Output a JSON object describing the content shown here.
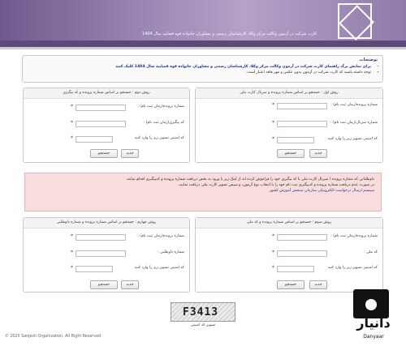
{
  "banner": {
    "text": "کارت شرکت در آزمون وکالت مرکز وکلا، کارشناسان رسمی و مشاوران خانواده قوه قضاییه سال 1404"
  },
  "notes": {
    "title": "توضیحات",
    "items": [
      "برای نمایش برگ راهنمای کارت شرکت در آزمون وکالت مرکز وکلا، کارشناسان رسمی و مشاوران خانواده قوه قضاییه سال 1404 کلیک کنید",
      "توجه داشته باشید که کارت شرکت در آزمون بدون عکس و مهر فاقد اعتبار است."
    ]
  },
  "panels": {
    "p1": {
      "title": "روش اول : جستجو بر اساس شماره پرونده و سریال کارت ملی",
      "fields": [
        "شماره پرونده(زمان ثبت نام) :",
        "شماره سریال(زمان ثبت نام) :",
        "کد امنیتی تصویر زیر را وارد کنید"
      ],
      "search": "جستجو",
      "new": "جدید"
    },
    "p2": {
      "title": "روش دوم : جستجو بر اساس شماره پرونده و کد پیگیری",
      "fields": [
        "شماره پرونده(زمان ثبت نام) :",
        "کد پیگیری(زمان ثبت نام) :",
        "کد امنیتی تصویر زیر را وارد کنید"
      ],
      "search": "جستجو",
      "new": "جدید"
    },
    "p3": {
      "title": "روش سوم : جستجو بر اساس شماره پرونده و کد ملی",
      "fields": [
        "شماره پرونده(زمان ثبت نام) :",
        "کد ملی :",
        "کد امنیتی تصویر زیر را وارد کنید"
      ],
      "search": "جستجو",
      "new": "جدید"
    },
    "p4": {
      "title": "روش چهارم : جستجو بر اساس شماره پرونده و شماره داوطلبی",
      "fields": [
        "شماره پرونده(زمان ثبت نام) :",
        "شماره داوطلبی :",
        "کد امنیتی تصویر زیر را وارد کنید"
      ],
      "search": "جستجو",
      "new": "جدید"
    }
  },
  "info": {
    "line1": "داوطلبانی که شماره پرونده / سریال کارت ملی یا کد پیگیری خود را فراموش کرده اند از لینک زیر با ورود به بخش دریافت شماره پرونده و کدپیگیری اقدام نمایند.",
    "line2": "در صورت عدم دریافت شماره پرونده و کدپیگیری ثبت نام خود را با انتخاب نوع آزمون، و سپس تصویر کارت ملی دریافت نمایید.",
    "link": "سیستم ارسال درخواست الکترونیکی سازمان سنجش آموزش کشور"
  },
  "captcha": {
    "code": "F3413",
    "label": "تصویر کد امنیتی"
  },
  "footer": {
    "text": "© 2025 Sanjesh Organization, All Right Reserved"
  },
  "watermark": {
    "text": "دانیار",
    "sub": "Danyaar"
  },
  "colors": {
    "accent": "#6e5a8c",
    "link": "#1a2ea8",
    "warning_bg": "#f9dcdc",
    "required": "#dd0000"
  }
}
